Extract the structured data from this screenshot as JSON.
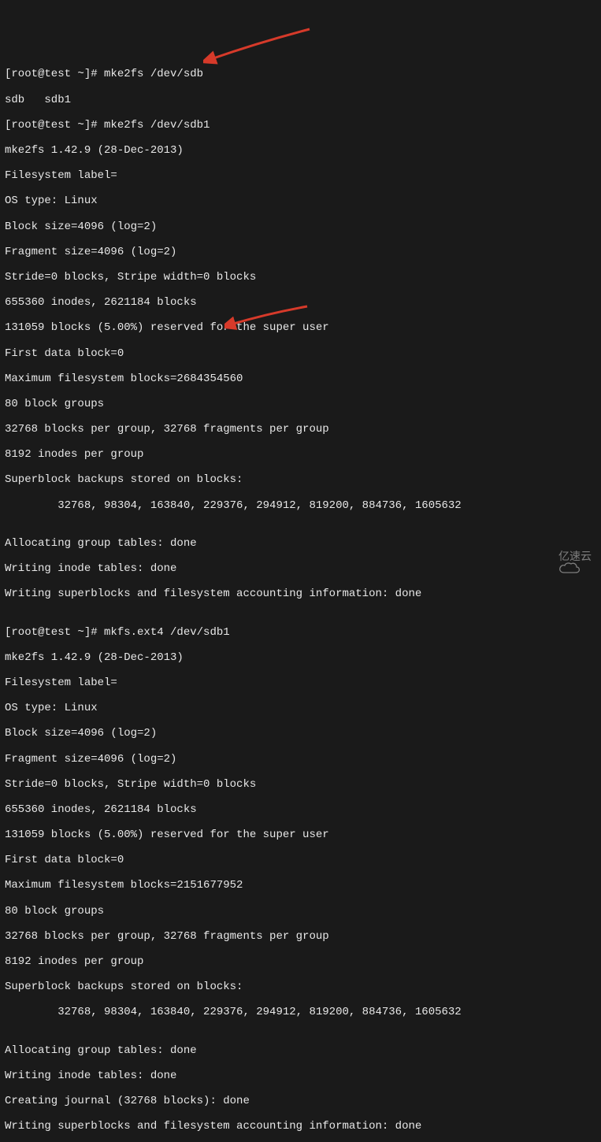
{
  "block1": {
    "prompt1": "[root@test ~]# mke2fs /dev/sdb",
    "l1": "sdb   sdb1",
    "prompt2": "[root@test ~]# mke2fs /dev/sdb1",
    "l2": "mke2fs 1.42.9 (28-Dec-2013)",
    "l3": "Filesystem label=",
    "l4": "OS type: Linux",
    "l5": "Block size=4096 (log=2)",
    "l6": "Fragment size=4096 (log=2)",
    "l7": "Stride=0 blocks, Stripe width=0 blocks",
    "l8": "655360 inodes, 2621184 blocks",
    "l9": "131059 blocks (5.00%) reserved for the super user",
    "l10": "First data block=0",
    "l11": "Maximum filesystem blocks=2684354560",
    "l12": "80 block groups",
    "l13": "32768 blocks per group, 32768 fragments per group",
    "l14": "8192 inodes per group",
    "l15": "Superblock backups stored on blocks:",
    "l16": "        32768, 98304, 163840, 229376, 294912, 819200, 884736, 1605632",
    "l17": "",
    "l18": "Allocating group tables: done",
    "l19": "Writing inode tables: done",
    "l20": "Writing superblocks and filesystem accounting information: done",
    "l21": ""
  },
  "block2": {
    "prompt1": "[root@test ~]# mkfs.ext4 /dev/sdb1",
    "l1": "mke2fs 1.42.9 (28-Dec-2013)",
    "l2": "Filesystem label=",
    "l3": "OS type: Linux",
    "l4": "Block size=4096 (log=2)",
    "l5": "Fragment size=4096 (log=2)",
    "l6": "Stride=0 blocks, Stripe width=0 blocks",
    "l7": "655360 inodes, 2621184 blocks",
    "l8": "131059 blocks (5.00%) reserved for the super user",
    "l9": "First data block=0",
    "l10": "Maximum filesystem blocks=2151677952",
    "l11": "80 block groups",
    "l12": "32768 blocks per group, 32768 fragments per group",
    "l13": "8192 inodes per group",
    "l14": "Superblock backups stored on blocks:",
    "l15": "        32768, 98304, 163840, 229376, 294912, 819200, 884736, 1605632",
    "l16": "",
    "l17": "Allocating group tables: done",
    "l18": "Writing inode tables: done",
    "l19": "Creating journal (32768 blocks): done",
    "l20": "Writing superblocks and filesystem accounting information: done"
  },
  "watermark": {
    "text": "亿速云"
  }
}
